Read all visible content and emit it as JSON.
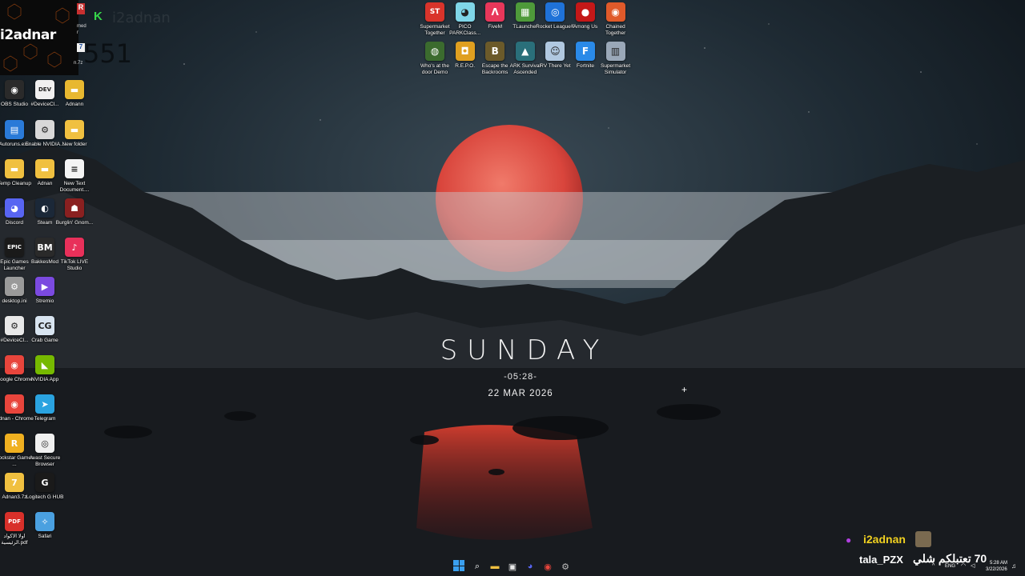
{
  "stream_overlay": {
    "username": "i2adnar",
    "ghost_name": "i2adnan",
    "ghost_number": "551",
    "k_badge": "K",
    "r_badge": "R",
    "partial_label_1": "med",
    "partial_label_2": "r",
    "partial_label_3": "n.7z"
  },
  "lock_clock": {
    "day": "SUNDAY",
    "time": "-05:28-",
    "date": "22 MAR 2026"
  },
  "top_icons": [
    {
      "label": "Supermarket Together",
      "glyph": "ST",
      "color": "#d9342b"
    },
    {
      "label": "PICO PARKClass...",
      "glyph": "◕",
      "color": "#7fd6e8"
    },
    {
      "label": "FiveM",
      "glyph": "Λ",
      "color": "#e8375a"
    },
    {
      "label": "TLauncher",
      "glyph": "▦",
      "color": "#4e9a3a"
    },
    {
      "label": "Rocket League®",
      "glyph": "◎",
      "color": "#1f72d8"
    },
    {
      "label": "Among Us",
      "glyph": "●",
      "color": "#c41818"
    },
    {
      "label": "Chained Together",
      "glyph": "◉",
      "color": "#e05a2a"
    },
    {
      "label": "Who's at the door Demo",
      "glyph": "◍",
      "color": "#3b6b2e"
    },
    {
      "label": "R.E.P.O.",
      "glyph": "◘",
      "color": "#e0a020"
    },
    {
      "label": "Escape the Backrooms",
      "glyph": "B",
      "color": "#6b5a2a"
    },
    {
      "label": "ARK Survival Ascended",
      "glyph": "▲",
      "color": "#2a6f7a"
    },
    {
      "label": "RV There Yet",
      "glyph": "☺",
      "color": "#b0c8e0"
    },
    {
      "label": "Fortnite",
      "glyph": "F",
      "color": "#2a8ae8"
    },
    {
      "label": "Supermarket Simulator",
      "glyph": "▥",
      "color": "#9aa8b8"
    }
  ],
  "left_icons": [
    {
      "label": "OBS Studio",
      "glyph": "◉",
      "color": "#2a2a2a"
    },
    {
      "label": "#DeviceCl...",
      "glyph": "DEV",
      "color": "#f0f0f0"
    },
    {
      "label": "Adnann",
      "glyph": "▬",
      "color": "#e8b830"
    },
    {
      "label": "Autoruns.exe",
      "glyph": "▤",
      "color": "#2a7ad8"
    },
    {
      "label": "Enable NVIDIA...",
      "glyph": "⚙",
      "color": "#d8d8d8"
    },
    {
      "label": "New folder",
      "glyph": "▬",
      "color": "#f0c040"
    },
    {
      "label": "Temp Cleanup",
      "glyph": "▬",
      "color": "#f0c040"
    },
    {
      "label": "Adnan",
      "glyph": "▬",
      "color": "#f0c040"
    },
    {
      "label": "New Text Document....",
      "glyph": "≡",
      "color": "#f4f4f4"
    },
    {
      "label": "Discord",
      "glyph": "◕",
      "color": "#5865f2"
    },
    {
      "label": "Steam",
      "glyph": "◐",
      "color": "#1b2838"
    },
    {
      "label": "Burglin' Gnom...",
      "glyph": "☗",
      "color": "#8a2020"
    },
    {
      "label": "Epic Games Launcher",
      "glyph": "EPIC",
      "color": "#1a1a1a"
    },
    {
      "label": "BakkesMod",
      "glyph": "BM",
      "color": "#2a2a2a"
    },
    {
      "label": "TikTok LIVE Studio",
      "glyph": "♪",
      "color": "#e8305a"
    },
    {
      "label": "desktop.ini",
      "glyph": "⚙",
      "color": "#9a9a9a"
    },
    {
      "label": "Stremio",
      "glyph": "▶",
      "color": "#7b4ae0"
    },
    {
      "label": "#DeviceCl...",
      "glyph": "⚙",
      "color": "#e8e8e8"
    },
    {
      "label": "Crab Game",
      "glyph": "CG",
      "color": "#d8e4f0"
    },
    {
      "label": "Google Chrome",
      "glyph": "◉",
      "color": "#e8453c"
    },
    {
      "label": "NVIDIA App",
      "glyph": "◣",
      "color": "#76b900"
    },
    {
      "label": "Adnan - Chrome",
      "glyph": "◉",
      "color": "#e8453c"
    },
    {
      "label": "Telegram",
      "glyph": "➤",
      "color": "#2aa3e0"
    },
    {
      "label": "Rockstar Games ...",
      "glyph": "R",
      "color": "#f0b020"
    },
    {
      "label": "Avast Secure Browser",
      "glyph": "◎",
      "color": "#f0f0f0"
    },
    {
      "label": "Adnan3.7z",
      "glyph": "7",
      "color": "#f0c040"
    },
    {
      "label": "Logitech G HUB",
      "glyph": "G",
      "color": "#1a1a1a"
    },
    {
      "label": "أولا الأكواد الرئيسية.pdf",
      "glyph": "PDF",
      "color": "#d8302a"
    },
    {
      "label": "Safari",
      "glyph": "✧",
      "color": "#4aa0e0"
    }
  ],
  "chat": {
    "user1": "i2adnan",
    "user2": "tala_PZX",
    "message": "70 تعتبلكم شلي"
  },
  "tray": {
    "lang": "ENG",
    "time": "5:28 AM",
    "date": "3/22/2026"
  },
  "colors": {
    "moon": "#e0544a",
    "chat_name": "#f0d020",
    "mic": "#b040e0"
  }
}
